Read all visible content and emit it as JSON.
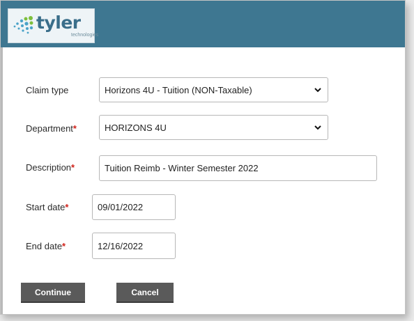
{
  "brand": {
    "name": "tyler",
    "tagline": "technologies"
  },
  "form": {
    "claim_type": {
      "label": "Claim type",
      "value": "Horizons 4U - Tuition (NON-Taxable)"
    },
    "department": {
      "label": "Department",
      "required_mark": "*",
      "value": "HORIZONS 4U"
    },
    "description": {
      "label": "Description",
      "required_mark": "*",
      "value": "Tuition Reimb - Winter Semester 2022"
    },
    "start_date": {
      "label": "Start date",
      "required_mark": "*",
      "value": "09/01/2022"
    },
    "end_date": {
      "label": "End date",
      "required_mark": "*",
      "value": "12/16/2022"
    }
  },
  "actions": {
    "continue_label": "Continue",
    "cancel_label": "Cancel"
  },
  "colors": {
    "header": "#3e7791",
    "button": "#5a5a5a",
    "required": "#d0221a"
  }
}
